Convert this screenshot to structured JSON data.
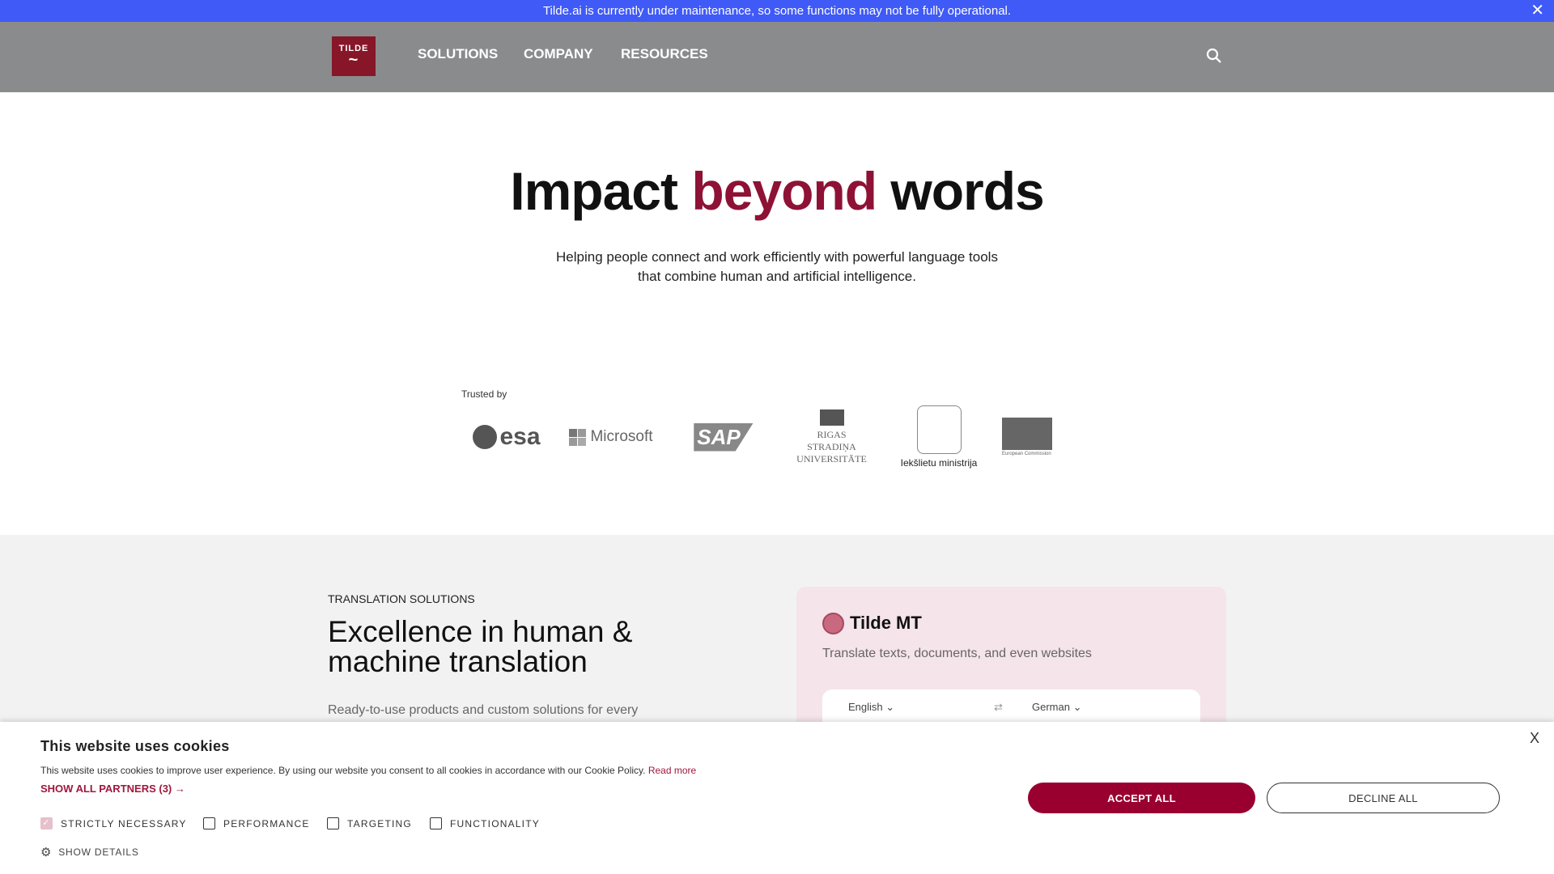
{
  "banner": {
    "text": "Tilde.ai is currently under maintenance, so some functions may not be fully operational.",
    "close": "✕",
    "color": "#3f5af6"
  },
  "nav": {
    "logo": "TILDE",
    "items": [
      "SOLUTIONS",
      "COMPANY",
      "RESOURCES"
    ],
    "search_icon": "search-icon"
  },
  "hero": {
    "title_start": "Impact ",
    "title_accent": "beyond",
    "title_end": " words",
    "accent_color": "#8e1235",
    "subtitle_line1": "Helping people connect and work efficiently with powerful language tools",
    "subtitle_line2": "that combine human and artificial intelligence."
  },
  "trusted": {
    "label": "Trusted by",
    "logos": [
      "esa",
      "Microsoft",
      "SAP",
      "RIGAS STRADIŅA UNIVERSITĀTE",
      "Iekšlietu ministrija",
      "European Commission"
    ]
  },
  "section": {
    "eyebrow": "TRANSLATION SOLUTIONS",
    "title": "Excellence in human & machine translation",
    "para": "Ready-to-use products and custom solutions for every"
  },
  "card": {
    "title": "Tilde MT",
    "subtitle": "Translate texts, documents, and even websites",
    "source_lang": "English",
    "target_lang": "German"
  },
  "cookie": {
    "title": "This website uses cookies",
    "text": "This website uses cookies to improve user experience. By using our website you consent to all cookies in accordance with our Cookie Policy.",
    "read_more": "Read more",
    "partners": "SHOW ALL PARTNERS (3) →",
    "categories": [
      {
        "label": "STRICTLY NECESSARY",
        "checked": true
      },
      {
        "label": "PERFORMANCE",
        "checked": false
      },
      {
        "label": "TARGETING",
        "checked": false
      },
      {
        "label": "FUNCTIONALITY",
        "checked": false
      }
    ],
    "show_details": "SHOW DETAILS",
    "accept": "ACCEPT ALL",
    "decline": "DECLINE ALL",
    "close": "X",
    "accent_color": "#990030"
  }
}
